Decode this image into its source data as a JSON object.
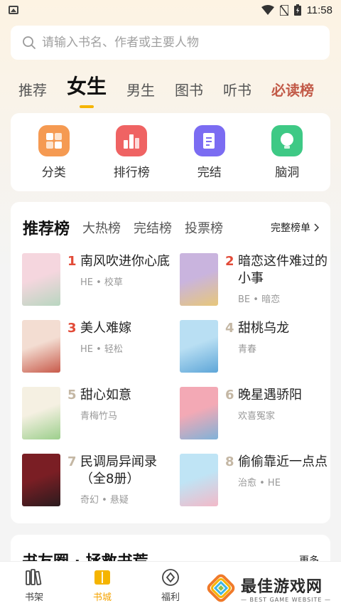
{
  "status_bar": {
    "time": "11:58"
  },
  "search": {
    "placeholder": "请输入书名、作者或主要人物"
  },
  "tabs": [
    {
      "label": "推荐"
    },
    {
      "label": "女生"
    },
    {
      "label": "男生"
    },
    {
      "label": "图书"
    },
    {
      "label": "听书"
    },
    {
      "label": "必读榜"
    }
  ],
  "categories": [
    {
      "label": "分类",
      "icon": "grid-icon",
      "color": "#f59a52"
    },
    {
      "label": "排行榜",
      "icon": "ranking-icon",
      "color": "#ef6363"
    },
    {
      "label": "完结",
      "icon": "document-icon",
      "color": "#7b6cf2"
    },
    {
      "label": "脑洞",
      "icon": "bulb-icon",
      "color": "#3ec985"
    }
  ],
  "ranking": {
    "tabs": [
      {
        "label": "推荐榜"
      },
      {
        "label": "大热榜"
      },
      {
        "label": "完结榜"
      },
      {
        "label": "投票榜"
      }
    ],
    "more_label": "完整榜单",
    "books": [
      {
        "rank": "1",
        "title": "南风吹进你心底",
        "tags": "HE • 校草",
        "cover_colors": [
          "#f5d6de",
          "#b8d6c0"
        ]
      },
      {
        "rank": "2",
        "title": "暗恋这件难过的小事",
        "tags": "BE • 暗恋",
        "cover_colors": [
          "#c9b4de",
          "#e7c77a"
        ]
      },
      {
        "rank": "3",
        "title": "美人难嫁",
        "tags": "HE • 轻松",
        "cover_colors": [
          "#f3ddd2",
          "#c85a4a"
        ]
      },
      {
        "rank": "4",
        "title": "甜桃乌龙",
        "tags": "青春",
        "cover_colors": [
          "#b9dff3",
          "#5ea6d8"
        ]
      },
      {
        "rank": "5",
        "title": "甜心如意",
        "tags": "青梅竹马",
        "cover_colors": [
          "#f5f0e2",
          "#9ccf8c"
        ]
      },
      {
        "rank": "6",
        "title": "晚星遇骄阳",
        "tags": "欢喜冤家",
        "cover_colors": [
          "#f3a9b5",
          "#7fb2d8"
        ]
      },
      {
        "rank": "7",
        "title": "民调局异闻录（全8册）",
        "tags": "奇幻 • 悬疑",
        "cover_colors": [
          "#7a1e24",
          "#2b1b1e"
        ]
      },
      {
        "rank": "8",
        "title": "偷偷靠近一点点",
        "tags": "治愈 • HE",
        "cover_colors": [
          "#bfe4f5",
          "#f2b9c8"
        ]
      }
    ]
  },
  "circle": {
    "title": "书友圈 · 拯救书荒",
    "more_label": "更多"
  },
  "bottom_nav": [
    {
      "label": "书架"
    },
    {
      "label": "书城"
    },
    {
      "label": "福利"
    },
    {
      "label": ""
    },
    {
      "label": ""
    }
  ],
  "watermark": {
    "main": "最佳游戏网",
    "sub": "— BEST GAME WEBSITE —"
  }
}
